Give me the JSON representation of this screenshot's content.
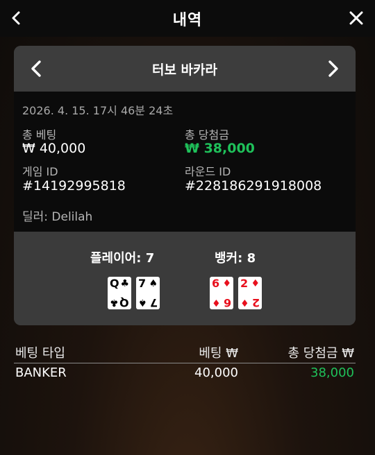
{
  "header": {
    "title": "내역"
  },
  "card": {
    "game_name": "터보 바카라",
    "timestamp": "2026. 4. 15. 17시 46분 24초",
    "total_bet_label": "총 베팅",
    "total_bet_value": "₩ 40,000",
    "total_win_label": "총 당첨금",
    "total_win_value": "₩ 38,000",
    "game_id_label": "게임 ID",
    "game_id_value": "#14192995818",
    "round_id_label": "라운드 ID",
    "round_id_value": "#228186291918008",
    "dealer": "딜러: Delilah"
  },
  "hands": {
    "player_label": "플레이어: 7",
    "banker_label": "뱅커: 8",
    "player_cards": [
      {
        "rank": "Q",
        "suit": "♣",
        "color": "#000000"
      },
      {
        "rank": "7",
        "suit": "♠",
        "color": "#000000"
      }
    ],
    "banker_cards": [
      {
        "rank": "6",
        "suit": "♦",
        "color": "#e8101d"
      },
      {
        "rank": "2",
        "suit": "♦",
        "color": "#e8101d"
      }
    ]
  },
  "bets": {
    "columns": [
      "베팅 타입",
      "베팅 ₩",
      "총 당첨금 ₩"
    ],
    "rows": [
      {
        "type": "BANKER",
        "bet": "40,000",
        "win": "38,000"
      }
    ]
  },
  "colors": {
    "accent_green": "#1fc15a",
    "card_red": "#e8101d"
  }
}
